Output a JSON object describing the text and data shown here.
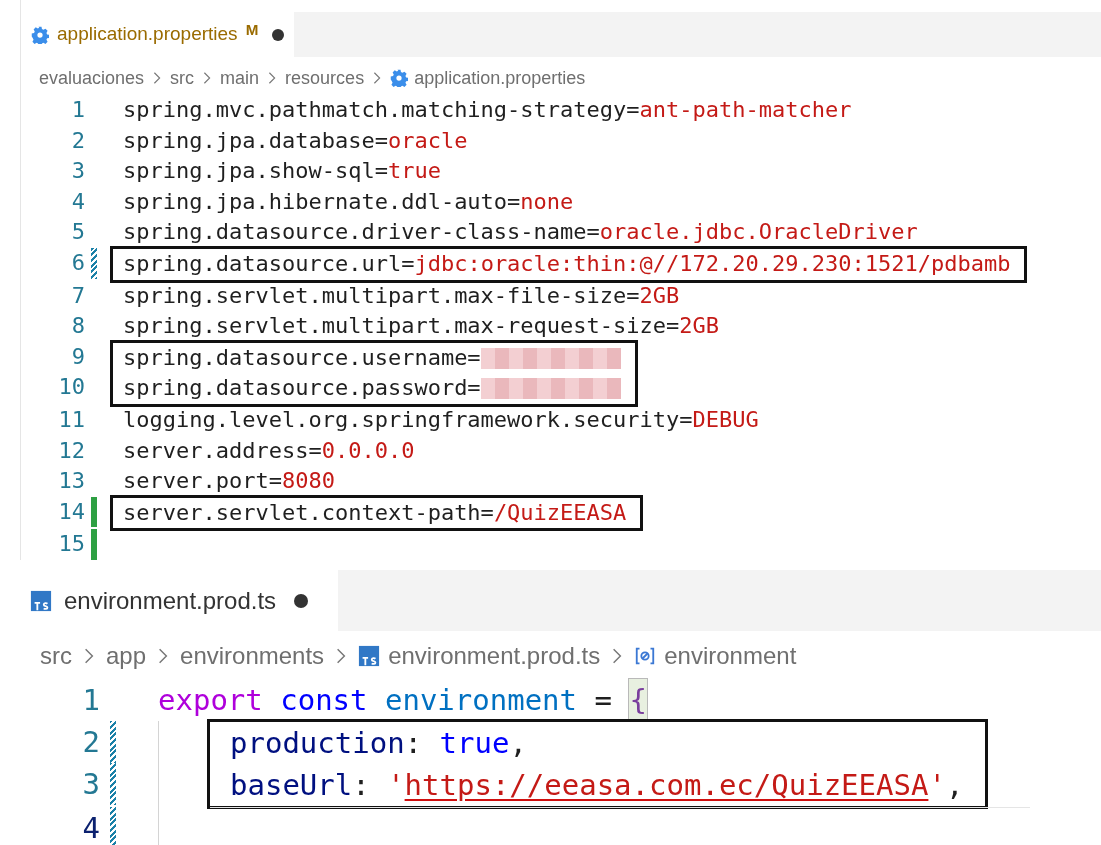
{
  "editors": [
    {
      "kind": "properties",
      "tab": {
        "label": "application.properties",
        "badge": "M",
        "dirty": true
      },
      "breadcrumbs": [
        {
          "label": "evaluaciones",
          "kind": "folder"
        },
        {
          "label": "src",
          "kind": "folder"
        },
        {
          "label": "main",
          "kind": "folder"
        },
        {
          "label": "resources",
          "kind": "folder"
        },
        {
          "label": "application.properties",
          "kind": "file"
        }
      ],
      "blocks": [
        {
          "boxed": false,
          "indented": false,
          "lines": [
            {
              "number": "1",
              "modified": false,
              "added": false,
              "tokens": [
                {
                  "text": "spring.mvc.pathmatch.matching-strategy=",
                  "kind": "key"
                },
                {
                  "text": "ant-path-matcher",
                  "kind": "value"
                }
              ]
            },
            {
              "number": "2",
              "modified": false,
              "added": false,
              "tokens": [
                {
                  "text": "spring.jpa.database=",
                  "kind": "key"
                },
                {
                  "text": "oracle",
                  "kind": "value"
                }
              ]
            },
            {
              "number": "3",
              "modified": false,
              "added": false,
              "tokens": [
                {
                  "text": "spring.jpa.show-sql=",
                  "kind": "key"
                },
                {
                  "text": "true",
                  "kind": "value"
                }
              ]
            },
            {
              "number": "4",
              "modified": false,
              "added": false,
              "tokens": [
                {
                  "text": "spring.jpa.hibernate.ddl-auto=",
                  "kind": "key"
                },
                {
                  "text": "none",
                  "kind": "value"
                }
              ]
            },
            {
              "number": "5",
              "modified": false,
              "added": false,
              "tokens": [
                {
                  "text": "spring.datasource.driver-class-name=",
                  "kind": "key"
                },
                {
                  "text": "oracle.jdbc.OracleDriver",
                  "kind": "value"
                }
              ]
            }
          ]
        },
        {
          "boxed": true,
          "indented": false,
          "lines": [
            {
              "number": "6",
              "modified": true,
              "added": false,
              "tokens": [
                {
                  "text": "spring.datasource.url=",
                  "kind": "key"
                },
                {
                  "text": "jdbc:oracle:thin:@//172.20.29.230:1521/pdbamb",
                  "kind": "value"
                }
              ]
            }
          ]
        },
        {
          "boxed": false,
          "indented": false,
          "lines": [
            {
              "number": "7",
              "modified": false,
              "added": false,
              "tokens": [
                {
                  "text": "spring.servlet.multipart.max-file-size=",
                  "kind": "key"
                },
                {
                  "text": "2GB",
                  "kind": "value"
                }
              ]
            },
            {
              "number": "8",
              "modified": false,
              "added": false,
              "tokens": [
                {
                  "text": "spring.servlet.multipart.max-request-size=",
                  "kind": "key"
                },
                {
                  "text": "2GB",
                  "kind": "value"
                }
              ]
            }
          ]
        },
        {
          "boxed": true,
          "indented": false,
          "lines": [
            {
              "number": "9",
              "modified": false,
              "added": false,
              "tokens": [
                {
                  "text": "spring.datasource.username=",
                  "kind": "key"
                },
                {
                  "kind": "redacted"
                }
              ]
            },
            {
              "number": "10",
              "modified": false,
              "added": false,
              "tokens": [
                {
                  "text": "spring.datasource.password=",
                  "kind": "key"
                },
                {
                  "kind": "redacted"
                }
              ]
            }
          ]
        },
        {
          "boxed": false,
          "indented": false,
          "lines": [
            {
              "number": "11",
              "modified": false,
              "added": false,
              "tokens": [
                {
                  "text": "logging.level.org.springframework.security=",
                  "kind": "key"
                },
                {
                  "text": "DEBUG",
                  "kind": "value"
                }
              ]
            },
            {
              "number": "12",
              "modified": false,
              "added": false,
              "tokens": [
                {
                  "text": "server.address=",
                  "kind": "key"
                },
                {
                  "text": "0.0.0.0",
                  "kind": "value"
                }
              ]
            },
            {
              "number": "13",
              "modified": false,
              "added": false,
              "tokens": [
                {
                  "text": "server.port=",
                  "kind": "key"
                },
                {
                  "text": "8080",
                  "kind": "value"
                }
              ]
            }
          ]
        },
        {
          "boxed": true,
          "indented": false,
          "lines": [
            {
              "number": "14",
              "modified": false,
              "added": true,
              "tokens": [
                {
                  "text": "server.servlet.context-path=",
                  "kind": "key"
                },
                {
                  "text": "/QuizEEASA",
                  "kind": "value"
                }
              ]
            }
          ]
        },
        {
          "boxed": false,
          "indented": false,
          "lines": [
            {
              "number": "15",
              "modified": false,
              "added": true,
              "current": false
            }
          ]
        }
      ]
    },
    {
      "kind": "typescript",
      "tab": {
        "label": "environment.prod.ts",
        "dirty": true
      },
      "breadcrumbs": [
        {
          "label": "src",
          "kind": "folder"
        },
        {
          "label": "app",
          "kind": "folder"
        },
        {
          "label": "environments",
          "kind": "folder"
        },
        {
          "label": "environment.prod.ts",
          "kind": "file"
        },
        {
          "label": "environment",
          "kind": "symbol"
        }
      ],
      "blocks": [
        {
          "boxed": false,
          "indented": false,
          "lines": [
            {
              "number": "1",
              "modified": false,
              "added": false,
              "tokens": [
                {
                  "text": "export ",
                  "kind": "keyword"
                },
                {
                  "text": "const ",
                  "kind": "storage"
                },
                {
                  "text": "environment ",
                  "kind": "constant"
                },
                {
                  "text": "= ",
                  "kind": "plain"
                },
                {
                  "text": "{",
                  "kind": "bracket"
                }
              ]
            }
          ]
        },
        {
          "boxed": true,
          "indented": true,
          "lines": [
            {
              "number": "2",
              "modified": true,
              "added": false,
              "tokens": [
                {
                  "text": "production",
                  "kind": "property"
                },
                {
                  "text": ": ",
                  "kind": "plain"
                },
                {
                  "text": "true",
                  "kind": "storage"
                },
                {
                  "text": ",",
                  "kind": "plain"
                }
              ]
            },
            {
              "number": "3",
              "modified": true,
              "added": false,
              "tokens": [
                {
                  "text": "baseUrl",
                  "kind": "property"
                },
                {
                  "text": ": ",
                  "kind": "plain"
                },
                {
                  "text": "'",
                  "kind": "value"
                },
                {
                  "text": "https://eeasa.com.ec/QuizEEASA",
                  "kind": "value",
                  "underlined": true
                },
                {
                  "text": "'",
                  "kind": "value"
                },
                {
                  "text": ",",
                  "kind": "plain"
                }
              ]
            }
          ]
        },
        {
          "boxed": false,
          "indented": true,
          "lines": [
            {
              "number": "4",
              "modified": true,
              "added": false,
              "current": true
            }
          ]
        }
      ]
    }
  ]
}
